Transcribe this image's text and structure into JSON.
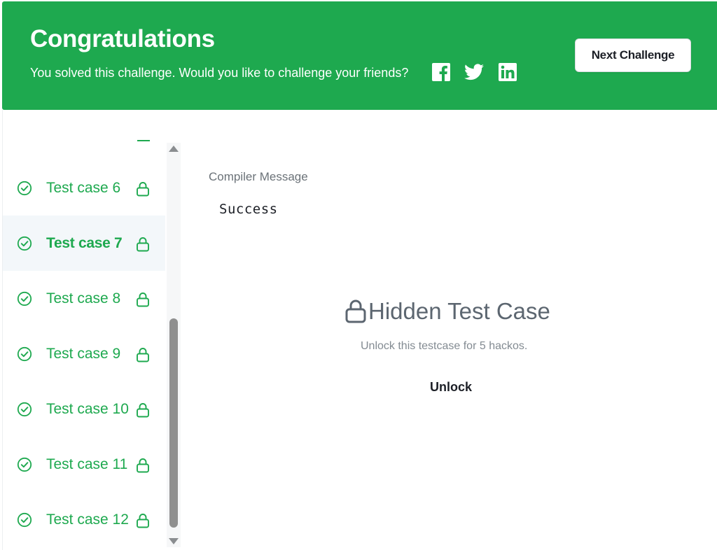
{
  "banner": {
    "title": "Congratulations",
    "subtitle": "You solved this challenge. Would you like to challenge your friends?",
    "share_icons": [
      "facebook-icon",
      "twitter-icon",
      "linkedin-icon"
    ],
    "next_button_label": "Next Challenge",
    "background_color": "#1ea94f"
  },
  "test_cases": {
    "items": [
      {
        "label": "Test case 6",
        "active": false,
        "status": "passed",
        "locked": true
      },
      {
        "label": "Test case 7",
        "active": true,
        "status": "passed",
        "locked": true
      },
      {
        "label": "Test case 8",
        "active": false,
        "status": "passed",
        "locked": true
      },
      {
        "label": "Test case 9",
        "active": false,
        "status": "passed",
        "locked": true
      },
      {
        "label": "Test case 10",
        "active": false,
        "status": "passed",
        "locked": true
      },
      {
        "label": "Test case 11",
        "active": false,
        "status": "passed",
        "locked": true
      },
      {
        "label": "Test case 12",
        "active": false,
        "status": "passed",
        "locked": true
      }
    ],
    "accent_color": "#1ea94f"
  },
  "result": {
    "compiler_label": "Compiler Message",
    "compiler_message": "Success",
    "hidden_title": "Hidden Test Case",
    "unlock_description": "Unlock this testcase for 5 hackos.",
    "unlock_label": "Unlock"
  }
}
